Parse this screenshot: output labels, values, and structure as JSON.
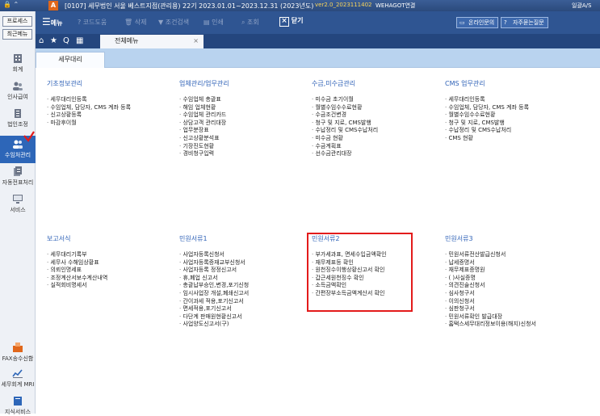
{
  "titlebar": {
    "title": "[0107] 세무법인 서울 베스트지점(관리용)  22기  2023.01.01~2023.12.31 (2023년도)",
    "version": "ver2.0_2023111402",
    "connection": "WEHAGOT연결",
    "window_label": "일괄A/S"
  },
  "sidebar": {
    "process_label": "프로세스",
    "recent_label": "최근메뉴",
    "items": [
      {
        "label": "회계",
        "icon": "building-icon"
      },
      {
        "label": "인사급여",
        "icon": "people-icon"
      },
      {
        "label": "법인조정",
        "icon": "office-icon"
      },
      {
        "label": "수임처관리",
        "icon": "users-icon"
      },
      {
        "label": "자동전표처리",
        "icon": "documents-icon"
      },
      {
        "label": "서비스",
        "icon": "monitor-icon"
      },
      {
        "label": "FAX송수신함",
        "icon": "fax-icon"
      },
      {
        "label": "세무회계 MRI",
        "icon": "chart-icon"
      },
      {
        "label": "지식서비스",
        "icon": "book-icon"
      }
    ]
  },
  "toolbar": {
    "menu_label": "메뉴",
    "code_help": "코드도움",
    "delete": "삭제",
    "filter": "조건검색",
    "print": "인쇄",
    "search": "조회",
    "close": "닫기",
    "online_inquiry": "온라인문의",
    "faq": "자주묻는질문"
  },
  "tabbar": {
    "tab_label": "전체메뉴",
    "close_mark": "×"
  },
  "subtab": {
    "label": "세무대리"
  },
  "sections": [
    {
      "title": "기초정보관리",
      "items": [
        "세무대리인등록",
        "수임업체, 담당자, CMS 계좌 등록",
        "신고상황등록",
        "마감후이월"
      ]
    },
    {
      "title": "업체관리/업무관리",
      "items": [
        "수임업체 총괄표",
        "해임 업체현황",
        "수임업체 관리카드",
        "상담고객 관리대장",
        "업무분장표",
        "신고상황분석표",
        "기장진도현황",
        "경비청구입력"
      ]
    },
    {
      "title": "수금,미수금관리",
      "items": [
        "미수금 초기이월",
        "월별수임수수료현황",
        "수금조건변경",
        "청구 및 지로, CMS발행",
        "수납정리 및 CMS수납처리",
        "미수금 현황",
        "수금계획표",
        "선수금관리대장"
      ]
    },
    {
      "title": "CMS 업무관리",
      "items": [
        "세무대리인등록",
        "수임업체, 담당자, CMS 계좌 등록",
        "월별수임수수료현황",
        "청구 및 지로, CMS발행",
        "수납정리 및 CMS수납처리",
        "CMS 현황"
      ]
    },
    {
      "title": "보고서식",
      "items": [
        "세무대리기록부",
        "세무사 수해임상황표",
        "의뢰인명세표",
        "조정계산서보수계산내역",
        "실적회비명세서"
      ]
    },
    {
      "title": "민원서류1",
      "items": [
        "사업자등록신청서",
        "사업자등록증재교부신청서",
        "사업자등록 정정신고서",
        "휴,폐업 신고서",
        "총괄납부승인,변경,포기신청",
        "임시사업장 개설,폐쇄신고서",
        "간이과세 적용,포기신고서",
        "면세적용,포기신고서",
        "다단계 판매원현황신고서",
        "사업양도신고서(구)"
      ]
    },
    {
      "title": "민원서류2",
      "items": [
        "부가세과표, 면세수입금액확인",
        "재무제표등 확인",
        "원천징수이행상황신고서 확인",
        "갑근세원천징수 확인",
        "소득금액확인",
        "간편장부소득금액계산서 확인"
      ]
    },
    {
      "title": "민원서류3",
      "items": [
        "민원서류전산발급신청서",
        "납세증명서",
        "재무제표증명원",
        "(   )사실증명",
        "의견진술신청서",
        "심사청구서",
        "이의신청서",
        "심판청구서",
        "민원서류확인 발급대장",
        "홈택스세무대리정보이용(해지)신청서"
      ]
    }
  ],
  "colors": {
    "accent": "#2f62b7",
    "highlight": "#e31b1b",
    "toolbar": "#2f5592"
  }
}
